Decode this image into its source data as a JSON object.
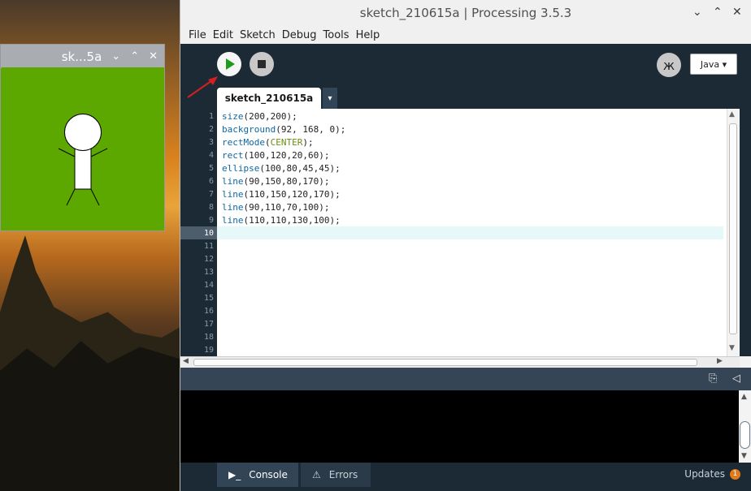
{
  "desktop": {
    "sketch_window": {
      "title": "sk...5a",
      "background_color": "#5ca800",
      "icons": [
        "chevron-down-icon",
        "chevron-up-icon",
        "close-icon"
      ]
    }
  },
  "main_window": {
    "title": "sketch_210615a | Processing 3.5.3",
    "controls": [
      "chevron-down-icon",
      "chevron-up-icon",
      "close-icon"
    ],
    "menu": [
      "File",
      "Edit",
      "Sketch",
      "Debug",
      "Tools",
      "Help"
    ],
    "toolbar": {
      "run_icon": "play-icon",
      "stop_icon": "stop-icon",
      "debug_icon": "butterfly-icon",
      "mode_label": "Java ▾"
    },
    "tab": {
      "label": "sketch_210615a",
      "menu_arrow": "▾"
    },
    "editor": {
      "line_numbers": [
        "1",
        "2",
        "3",
        "4",
        "5",
        "6",
        "7",
        "8",
        "9",
        "10",
        "11",
        "12",
        "13",
        "14",
        "15",
        "16",
        "17",
        "18",
        "19"
      ],
      "current_line": "10",
      "code_lines": [
        "size(200,200);",
        "background(92, 168, 0);",
        "rectMode(CENTER);",
        "rect(100,120,20,60);",
        "ellipse(100,80,45,45);",
        "line(90,150,80,170);",
        "line(110,150,120,170);",
        "line(90,110,70,100);",
        "line(110,110,130,100);"
      ]
    },
    "footer": {
      "console_label": "Console",
      "errors_label": "Errors",
      "updates_label": "Updates",
      "updates_count": "1"
    }
  }
}
